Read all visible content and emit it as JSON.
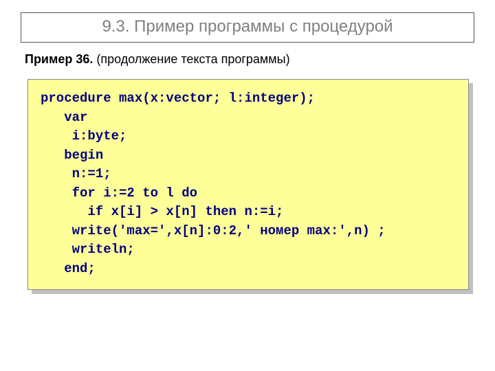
{
  "title": "9.3. Пример  программы с процедурой",
  "subtitle_label": "Пример 36.",
  "subtitle_rest": "  (продолжение текста программы)",
  "code": [
    "procedure max(x:vector; l:integer);",
    "   var",
    "    i:byte;",
    "   begin",
    "    n:=1;",
    "    for i:=2 to l do",
    "      if x[i] > x[n] then n:=i;",
    "    write('max=',x[n]:0:2,' номер max:',n) ;",
    "    writeln;",
    "   end;"
  ]
}
